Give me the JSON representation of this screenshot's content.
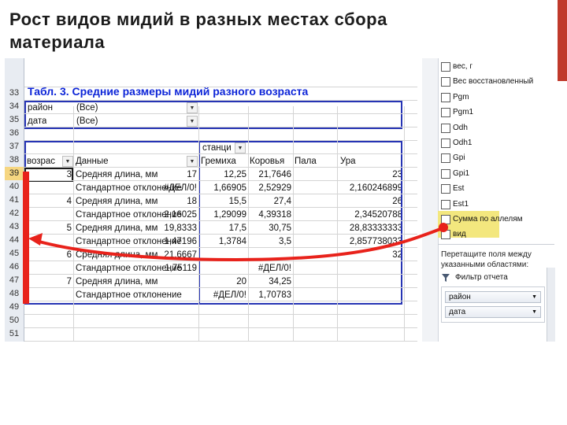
{
  "slide": {
    "title": "Рост видов мидий в разных местах сбора материала"
  },
  "sheet": {
    "row_numbers": [
      "33",
      "34",
      "35",
      "36",
      "37",
      "38",
      "39",
      "40",
      "41",
      "42",
      "43",
      "44",
      "45",
      "46",
      "47",
      "48",
      "49",
      "50",
      "51"
    ],
    "table_title": "Табл. 3. Средние размеры мидий разного возраста",
    "filters": [
      {
        "field": "район",
        "value": "(Все)"
      },
      {
        "field": "дата",
        "value": "(Все)"
      }
    ],
    "column_field": "станци",
    "row_field": "возрас",
    "data_field": "Данные",
    "columns": [
      "Гремиха",
      "Коровья",
      "Пала",
      "Ура"
    ],
    "rows": [
      {
        "age": "3",
        "measure": "Средняя длина, мм",
        "values": [
          "17",
          "12,25",
          "21,7646",
          "23"
        ]
      },
      {
        "age": "",
        "measure": "Стандартное отклонение",
        "values": [
          "#ДЕЛ/0!",
          "1,66905",
          "2,52929",
          "2,160246899"
        ]
      },
      {
        "age": "4",
        "measure": "Средняя длина, мм",
        "values": [
          "18",
          "15,5",
          "27,4",
          "26"
        ]
      },
      {
        "age": "",
        "measure": "Стандартное отклонение",
        "values": [
          "2,16025",
          "1,29099",
          "4,39318",
          "2,34520788"
        ]
      },
      {
        "age": "5",
        "measure": "Средняя длина, мм",
        "values": [
          "19,8333",
          "17,5",
          "30,75",
          "28,83333333"
        ]
      },
      {
        "age": "",
        "measure": "Стандартное отклонение",
        "values": [
          "1,47196",
          "1,3784",
          "3,5",
          "2,857738033"
        ]
      },
      {
        "age": "6",
        "measure": "Средняя длина, мм",
        "values": [
          "21,6667",
          "",
          "",
          "32"
        ]
      },
      {
        "age": "",
        "measure": "Стандартное отклонение",
        "values": [
          "1,75119",
          "",
          "#ДЕЛ/0!",
          ""
        ]
      },
      {
        "age": "7",
        "measure": "Средняя длина, мм",
        "values": [
          "",
          "20",
          "34,25",
          ""
        ]
      },
      {
        "age": "",
        "measure": "Стандартное отклонение",
        "values": [
          "",
          "#ДЕЛ/0!",
          "1,70783",
          ""
        ]
      }
    ]
  },
  "panel": {
    "fields": [
      "вес, г",
      "Вес восстановленный",
      "Pgm",
      "Pgm1",
      "Odh",
      "Odh1",
      "Gpi",
      "Gpi1",
      "Est",
      "Est1",
      "Сумма по аллелям",
      "вид"
    ],
    "hint": "Перетащите поля между указанными областями:",
    "report_filter_title": "Фильтр отчета",
    "report_filter_fields": [
      "район",
      "дата"
    ]
  },
  "colors": {
    "title_blue": "#0e26d8",
    "pivot_border": "#2634b4",
    "annotation_red": "#e8221b",
    "highlight_yellow": "#f3e77e",
    "accent_red": "#c0392b"
  }
}
